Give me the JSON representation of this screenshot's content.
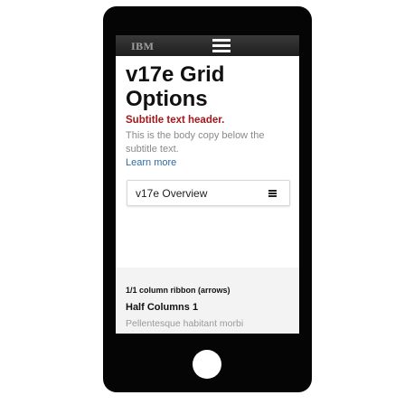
{
  "header": {
    "logo": "IBM",
    "menu_icon": "hamburger-icon"
  },
  "hero": {
    "title": "v17e Grid Options",
    "subtitle": "Subtitle text header.",
    "body": "This is the body copy below the subtitle text.",
    "link": "Learn more"
  },
  "dropdown": {
    "label": "v17e Overview",
    "icon": "list-icon"
  },
  "section": {
    "ribbon": "1/1 column ribbon (arrows)",
    "heading": "Half Columns 1",
    "body": "Pellentesque habitant morbi"
  },
  "colors": {
    "accent": "#a4171b",
    "link": "#2d6ca7",
    "device": "#050505"
  }
}
